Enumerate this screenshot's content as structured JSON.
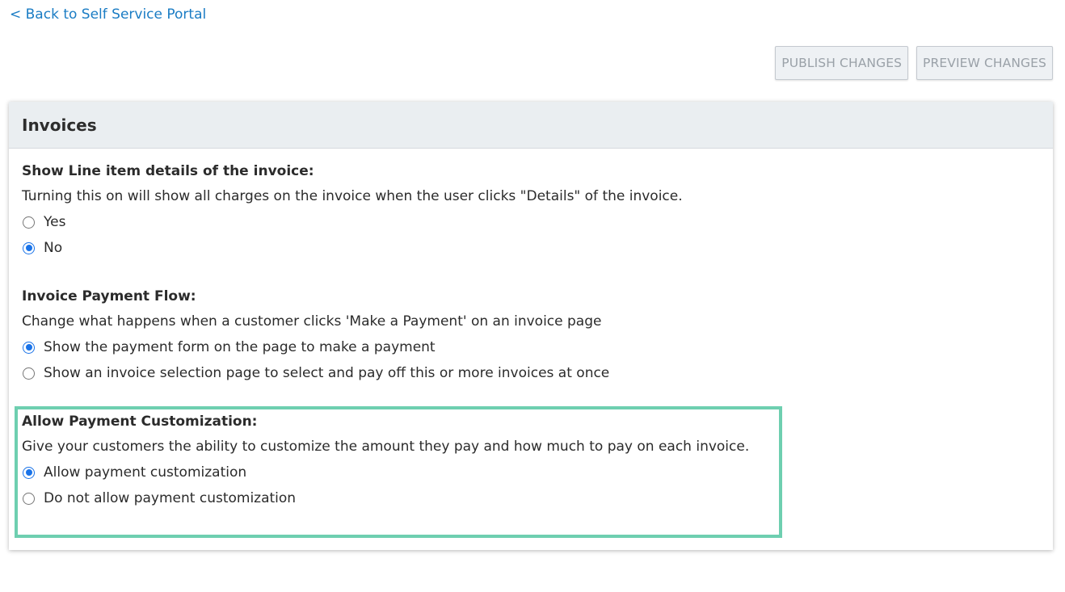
{
  "nav": {
    "back_label": "< Back to Self Service Portal"
  },
  "toolbar": {
    "publish_label": "PUBLISH CHANGES",
    "preview_label": "PREVIEW CHANGES"
  },
  "card": {
    "title": "Invoices",
    "sections": [
      {
        "title": "Show Line item details of the invoice:",
        "description": "Turning this on will show all charges on the invoice when the user clicks \"Details\" of the invoice.",
        "options": [
          {
            "label": "Yes",
            "checked": false
          },
          {
            "label": "No",
            "checked": true
          }
        ]
      },
      {
        "title": "Invoice Payment Flow:",
        "description": "Change what happens when a customer clicks 'Make a Payment' on an invoice page",
        "options": [
          {
            "label": "Show the payment form on the page to make a payment",
            "checked": true
          },
          {
            "label": "Show an invoice selection page to select and pay off this or more invoices at once",
            "checked": false
          }
        ]
      },
      {
        "title": "Allow Payment Customization:",
        "description": "Give your customers the ability to customize the amount they pay and how much to pay on each invoice.",
        "options": [
          {
            "label": "Allow payment customization",
            "checked": true
          },
          {
            "label": "Do not allow payment customization",
            "checked": false
          }
        ]
      }
    ]
  },
  "colors": {
    "link": "#1a7cc4",
    "radio_checked": "#1a73e8",
    "highlight": "#6ecfb0",
    "header_bg": "#eaeef1"
  }
}
